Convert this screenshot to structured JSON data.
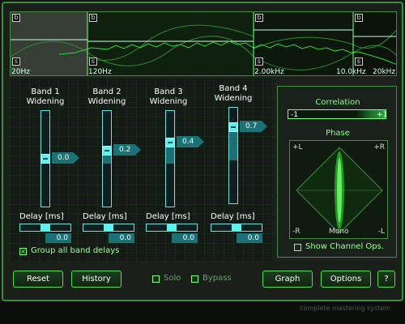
{
  "spectrum": {
    "freq_labels": [
      "20Hz",
      "120Hz",
      "2.00kHz",
      "10.0kHz",
      "20kHz"
    ],
    "band_marker_label": "b",
    "solo_marker_label": "s"
  },
  "bands": [
    {
      "label": "Band 1",
      "sublabel": "Widening",
      "value": "0.0",
      "level": 0.0
    },
    {
      "label": "Band 2",
      "sublabel": "Widening",
      "value": "0.2",
      "level": 0.2
    },
    {
      "label": "Band 3",
      "sublabel": "Widening",
      "value": "0.4",
      "level": 0.4
    },
    {
      "label": "Band 4",
      "sublabel": "Widening",
      "value": "0.7",
      "level": 0.7
    }
  ],
  "delays": [
    {
      "label": "Delay [ms]",
      "value": "0.0",
      "level": 0.5
    },
    {
      "label": "Delay [ms]",
      "value": "0.0",
      "level": 0.5
    },
    {
      "label": "Delay [ms]",
      "value": "0.0",
      "level": 0.5
    },
    {
      "label": "Delay [ms]",
      "value": "0.0",
      "level": 0.5
    }
  ],
  "group_delays": {
    "label": "Group all band delays",
    "checked": true
  },
  "correlation": {
    "title": "Correlation",
    "min_label": "-1",
    "max_label": "+1",
    "level": 0.9
  },
  "phase": {
    "title": "Phase",
    "labels": {
      "top_left": "+L",
      "top_right": "+R",
      "bottom_left": "-R",
      "bottom_center": "Mono",
      "bottom_right": "-L"
    }
  },
  "show_channel_ops": {
    "label": "Show Channel Ops.",
    "checked": false
  },
  "buttons": {
    "reset": "Reset",
    "history": "History",
    "solo": "Solo",
    "bypass": "Bypass",
    "graph": "Graph",
    "options": "Options",
    "help": "?"
  },
  "footer": {
    "text": "complete mastering system"
  },
  "colors": {
    "accent": "#3c8f3c",
    "cyan": "#5ff0f0",
    "panel": "#1c211c"
  }
}
